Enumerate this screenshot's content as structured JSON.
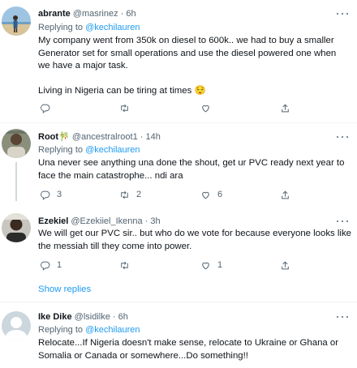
{
  "tweets": [
    {
      "name": "abrante",
      "handle": "@masrinez",
      "time": "6h",
      "replying_label": "Replying to",
      "replying_to": "@kechilauren",
      "lines": [
        "My company went from 350k on diesel to 600k.. we had to buy a smaller",
        "Generator set for small operations and use the diesel powered one when",
        "we have a major task.",
        "",
        "Living in Nigeria can be tiring at times 😌"
      ],
      "reply_count": "",
      "retweet_count": "",
      "like_count": ""
    },
    {
      "name": "Root🎋",
      "handle": "@ancestralroot1",
      "time": "14h",
      "replying_label": "Replying to",
      "replying_to": "@kechilauren",
      "lines": [
        "Una never see anything una done the shout, get ur PVC ready next year to",
        "face the main catastrophe... ndi ara"
      ],
      "reply_count": "3",
      "retweet_count": "2",
      "like_count": "6"
    },
    {
      "name": "Ezekiel",
      "handle": "@Ezekiiel_Ikenna",
      "time": "3h",
      "lines": [
        "We will get our PVC sir.. but who do we vote for because everyone looks like",
        "the messiah till they come into power."
      ],
      "reply_count": "1",
      "retweet_count": "",
      "like_count": "1"
    },
    {
      "name": "Ike Dike",
      "handle": "@lsidilke",
      "time": "6h",
      "replying_label": "Replying to",
      "replying_to": "@kechilauren",
      "lines": [
        "Relocate...If Nigeria doesn't make sense, relocate to Ukraine or Ghana or",
        "Somalia or Canada or somewhere...Do something!!"
      ]
    }
  ],
  "show_replies": "Show replies",
  "dot": "·",
  "colors": {
    "accent": "#1d9bf0",
    "secondary": "#536471",
    "divider": "#eff3f4"
  },
  "icons": [
    "reply-icon",
    "retweet-icon",
    "like-icon",
    "share-icon",
    "more-icon"
  ]
}
